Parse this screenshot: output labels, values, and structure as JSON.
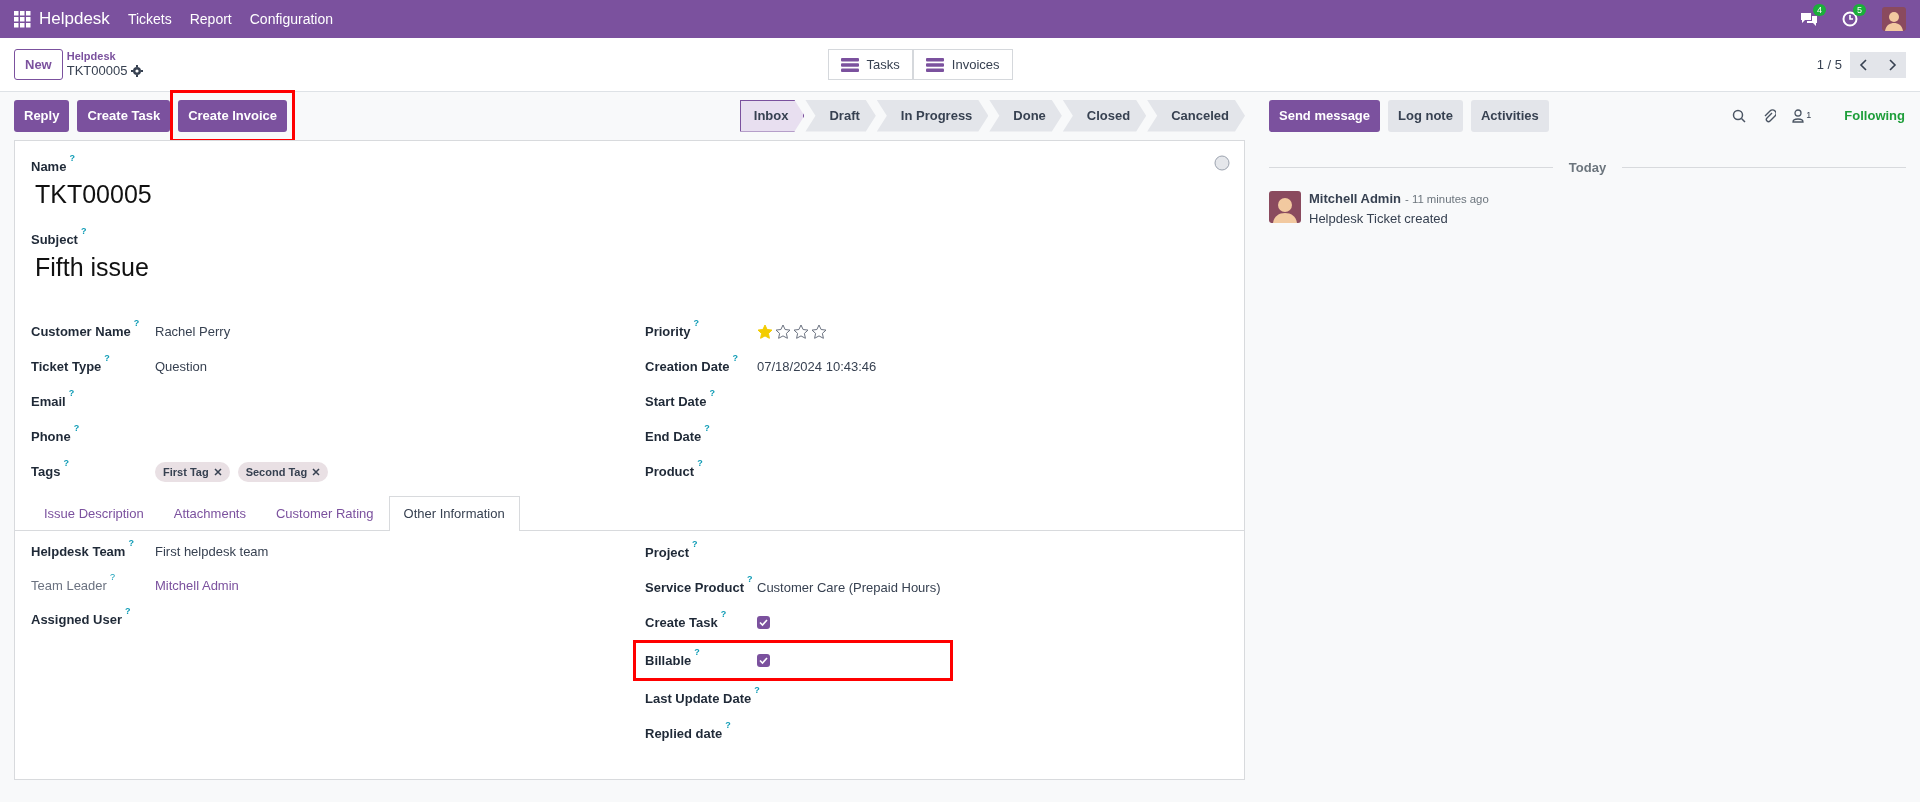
{
  "navbar": {
    "app": "Helpdesk",
    "menus": [
      "Tickets",
      "Report",
      "Configuration"
    ],
    "messages_count": "4",
    "activities_count": "5"
  },
  "control_panel": {
    "new_button": "New",
    "breadcrumb": "Helpdesk",
    "record": "TKT00005",
    "smart_buttons": [
      "Tasks",
      "Invoices"
    ],
    "pager": "1 / 5"
  },
  "actions": [
    {
      "label": "Reply",
      "highlighted": false
    },
    {
      "label": "Create Task",
      "highlighted": false
    },
    {
      "label": "Create Invoice",
      "highlighted": true
    }
  ],
  "stages": [
    {
      "label": "Inbox",
      "selected": true
    },
    {
      "label": "Draft",
      "selected": false
    },
    {
      "label": "In Progress",
      "selected": false
    },
    {
      "label": "Done",
      "selected": false
    },
    {
      "label": "Closed",
      "selected": false
    },
    {
      "label": "Canceled",
      "selected": false
    }
  ],
  "form": {
    "name_label": "Name",
    "name_help": "?",
    "name": "TKT00005",
    "subject_label": "Subject",
    "subject_help": "?",
    "subject": "Fifth issue",
    "left_fields": [
      {
        "kind": "text",
        "label": "Customer Name",
        "help": "?",
        "value": "Rachel Perry"
      },
      {
        "kind": "text",
        "label": "Ticket Type",
        "help": "?",
        "value": "Question"
      },
      {
        "kind": "text",
        "label": "Email",
        "help": "?"
      },
      {
        "kind": "text",
        "label": "Phone",
        "help": "?"
      },
      {
        "kind": "tags",
        "label": "Tags",
        "help": "?",
        "tags": [
          "First Tag",
          "Second Tag"
        ]
      }
    ],
    "right_fields": [
      {
        "kind": "stars",
        "label": "Priority",
        "help": "?",
        "stars": 1
      },
      {
        "kind": "text",
        "label": "Creation Date",
        "help": "?",
        "value": "07/18/2024 10:43:46"
      },
      {
        "kind": "text",
        "label": "Start Date",
        "help": "?"
      },
      {
        "kind": "text",
        "label": "End Date",
        "help": "?"
      },
      {
        "kind": "text",
        "label": "Product",
        "help": "?"
      }
    ],
    "tabs": [
      {
        "label": "Issue Description",
        "selected": false
      },
      {
        "label": "Attachments",
        "selected": false
      },
      {
        "label": "Customer Rating",
        "selected": false
      },
      {
        "label": "Other Information",
        "selected": true
      }
    ],
    "tab_left_fields": [
      {
        "kind": "text",
        "label": "Helpdesk Team",
        "help": "?",
        "value": "First helpdesk team",
        "muted": false
      },
      {
        "kind": "link",
        "label": "Team Leader",
        "help": "?",
        "value": "Mitchell Admin",
        "muted": true
      },
      {
        "kind": "text",
        "label": "Assigned User",
        "help": "?",
        "muted": false
      }
    ],
    "tab_right_fields": [
      {
        "kind": "text",
        "label": "Project",
        "help": "?",
        "highlighted": false
      },
      {
        "kind": "text",
        "label": "Service Product",
        "help": "?",
        "value": "Customer Care (Prepaid Hours)",
        "highlighted": false
      },
      {
        "kind": "checkbox",
        "label": "Create Task",
        "help": "?",
        "checked": true,
        "highlighted": false
      },
      {
        "kind": "checkbox",
        "label": "Billable",
        "help": "?",
        "checked": true,
        "highlighted": true
      },
      {
        "kind": "text",
        "label": "Last Update Date",
        "help": "?",
        "highlighted": false
      },
      {
        "kind": "text",
        "label": "Replied date",
        "help": "?",
        "highlighted": false
      }
    ]
  },
  "chatter": {
    "buttons": [
      {
        "label": "Send message",
        "selected": true
      },
      {
        "label": "Log note",
        "selected": false
      },
      {
        "label": "Activities",
        "selected": false
      }
    ],
    "followers_count": "1",
    "following": "Following",
    "date_separator": "Today",
    "messages": [
      {
        "author": "Mitchell Admin",
        "time": "- 11 minutes ago",
        "body": "Helpdesk Ticket created"
      }
    ]
  }
}
